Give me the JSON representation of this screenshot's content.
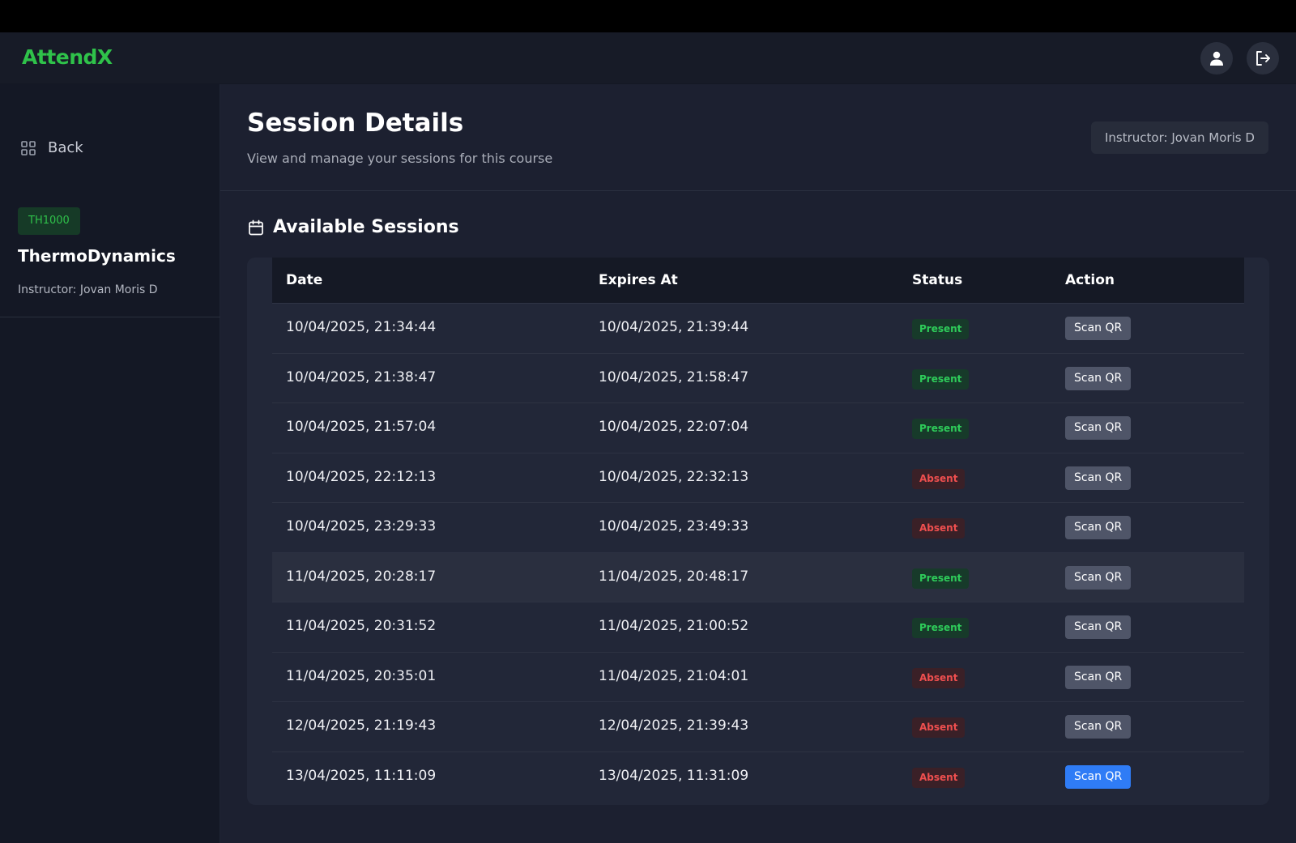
{
  "app": {
    "logo": "AttendX"
  },
  "header": {
    "profile_icon": "user-icon",
    "logout_icon": "logout-icon"
  },
  "sidebar": {
    "back_label": "Back",
    "course": {
      "code": "TH1000",
      "name": "ThermoDynamics",
      "instructor": "Instructor: Jovan Moris D"
    }
  },
  "main": {
    "title": "Session Details",
    "subtitle": "View and manage your sessions for this course",
    "instructor_pill": "Instructor: Jovan Moris D",
    "section_title": "Available Sessions",
    "columns": [
      "Date",
      "Expires At",
      "Status",
      "Action"
    ],
    "sessions": [
      {
        "date": "10/04/2025, 21:34:44",
        "expires": "10/04/2025, 21:39:44",
        "status": "Present",
        "action": "Scan QR"
      },
      {
        "date": "10/04/2025, 21:38:47",
        "expires": "10/04/2025, 21:58:47",
        "status": "Present",
        "action": "Scan QR"
      },
      {
        "date": "10/04/2025, 21:57:04",
        "expires": "10/04/2025, 22:07:04",
        "status": "Present",
        "action": "Scan QR"
      },
      {
        "date": "10/04/2025, 22:12:13",
        "expires": "10/04/2025, 22:32:13",
        "status": "Absent",
        "action": "Scan QR"
      },
      {
        "date": "10/04/2025, 23:29:33",
        "expires": "10/04/2025, 23:49:33",
        "status": "Absent",
        "action": "Scan QR"
      },
      {
        "date": "11/04/2025, 20:28:17",
        "expires": "11/04/2025, 20:48:17",
        "status": "Present",
        "action": "Scan QR"
      },
      {
        "date": "11/04/2025, 20:31:52",
        "expires": "11/04/2025, 21:00:52",
        "status": "Present",
        "action": "Scan QR"
      },
      {
        "date": "11/04/2025, 20:35:01",
        "expires": "11/04/2025, 21:04:01",
        "status": "Absent",
        "action": "Scan QR"
      },
      {
        "date": "12/04/2025, 21:19:43",
        "expires": "12/04/2025, 21:39:43",
        "status": "Absent",
        "action": "Scan QR"
      },
      {
        "date": "13/04/2025, 11:11:09",
        "expires": "13/04/2025, 11:31:09",
        "status": "Absent",
        "action": "Scan QR"
      }
    ]
  },
  "colors": {
    "brand": "#2fc24a",
    "present": "#2ecc5a",
    "absent": "#ef4f4f",
    "primary_button": "#2f7cf6"
  }
}
